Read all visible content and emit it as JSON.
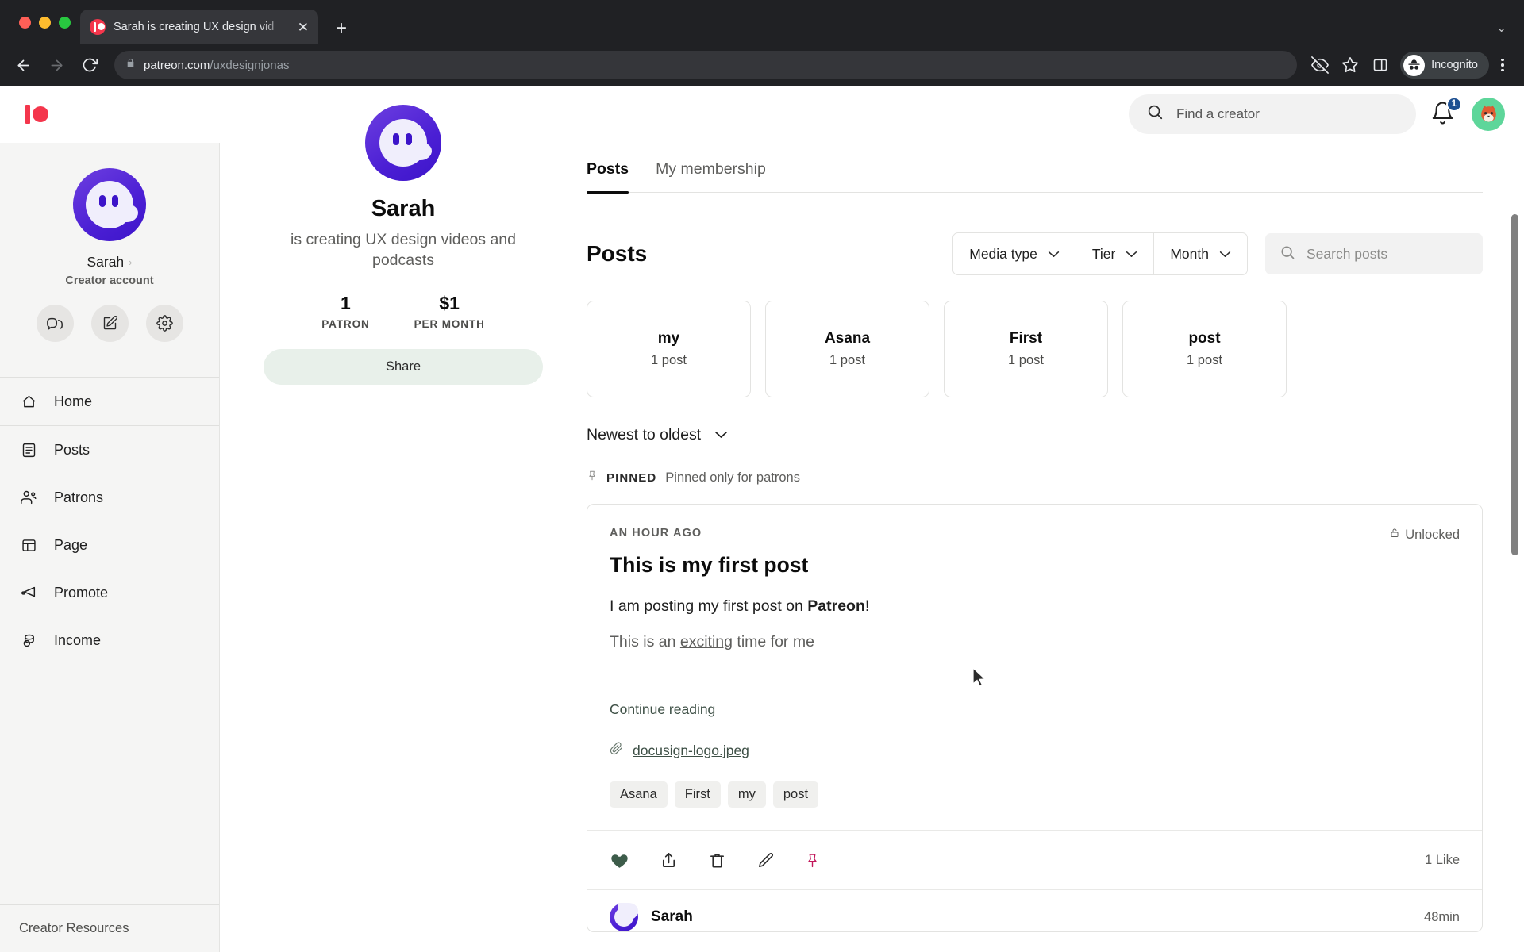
{
  "browser": {
    "tab": {
      "title": "Sarah is creating UX design vid",
      "favicon": "patreon-favicon",
      "close": "✕"
    },
    "newtab_label": "+",
    "tabstrip_chevron": "⌄",
    "back_label": "←",
    "forward_label": "→",
    "reload_label": "↻",
    "url_domain": "patreon.com",
    "url_path": "/uxdesignjonas",
    "profile_label": "Incognito",
    "icons": [
      "lock-icon",
      "eye-off-icon",
      "star-icon",
      "side-panel-icon",
      "incognito-icon",
      "kebab-menu-icon"
    ]
  },
  "topnav": {
    "logo": "patreon-logo",
    "search": {
      "placeholder": "Find a creator",
      "value": ""
    },
    "notifications": {
      "count": "1",
      "badge_color": "#1d4f91"
    },
    "avatar": "fox-avatar"
  },
  "sidebar": {
    "profile": {
      "name": "Sarah",
      "role": "Creator account",
      "chevron": "›",
      "avatar": "ghost-avatar"
    },
    "quick_actions": [
      {
        "name": "messages-button",
        "icon": "chat-bubbles-icon"
      },
      {
        "name": "compose-button",
        "icon": "pencil-square-icon"
      },
      {
        "name": "settings-button",
        "icon": "gear-icon"
      }
    ],
    "items": [
      {
        "label": "Home",
        "icon": "home-icon"
      },
      {
        "label": "Posts",
        "icon": "document-icon"
      },
      {
        "label": "Patrons",
        "icon": "people-icon"
      },
      {
        "label": "Page",
        "icon": "layout-icon"
      },
      {
        "label": "Promote",
        "icon": "megaphone-icon"
      },
      {
        "label": "Income",
        "icon": "coins-icon"
      }
    ],
    "footer_label": "Creator Resources"
  },
  "creator": {
    "avatar": "ghost-avatar",
    "name": "Sarah",
    "tagline": "is creating UX design videos and podcasts",
    "stats": [
      {
        "value": "1",
        "label": "PATRON"
      },
      {
        "value": "$1",
        "label": "PER MONTH"
      }
    ],
    "share_label": "Share"
  },
  "main": {
    "tabs": [
      {
        "label": "Posts",
        "active": true
      },
      {
        "label": "My membership",
        "active": false
      }
    ],
    "heading": "Posts",
    "filters": [
      {
        "label": "Media type",
        "icon": "chevron-down-icon"
      },
      {
        "label": "Tier",
        "icon": "chevron-down-icon"
      },
      {
        "label": "Month",
        "icon": "chevron-down-icon"
      }
    ],
    "search_posts": {
      "placeholder": "Search posts",
      "value": ""
    },
    "tag_cards": [
      {
        "title": "my",
        "subtitle": "1 post"
      },
      {
        "title": "Asana",
        "subtitle": "1 post"
      },
      {
        "title": "First",
        "subtitle": "1 post"
      },
      {
        "title": "post",
        "subtitle": "1 post"
      }
    ],
    "sort": {
      "label": "Newest to oldest",
      "icon": "chevron-down-icon"
    },
    "pinned": {
      "keyword": "PINNED",
      "note": "Pinned only for patrons",
      "icon": "pin-icon"
    },
    "post": {
      "timestamp": "AN HOUR AGO",
      "lock_status": "Unlocked",
      "lock_icon": "unlock-icon",
      "title": "This is my first post",
      "paragraph_1_pre": "I am posting my first post on ",
      "paragraph_1_bold": "Patreon",
      "paragraph_1_post": "!",
      "paragraph_2_pre": "This is an ",
      "paragraph_2_link": "exciting",
      "paragraph_2_post": " time for me",
      "continue_label": "Continue reading",
      "attachment": {
        "name": "docusign-logo.jpeg",
        "icon": "paperclip-icon"
      },
      "chips": [
        "Asana",
        "First",
        "my",
        "post"
      ],
      "actions": [
        {
          "name": "like-button",
          "icon": "heart-filled-icon",
          "color": "#3d5c4a"
        },
        {
          "name": "share-button",
          "icon": "share-up-icon",
          "color": "#2b2b2b"
        },
        {
          "name": "delete-button",
          "icon": "trash-icon",
          "color": "#2b2b2b"
        },
        {
          "name": "edit-button",
          "icon": "pencil-icon",
          "color": "#2b2b2b"
        },
        {
          "name": "unpin-button",
          "icon": "pin-icon",
          "color": "#c2185b"
        }
      ],
      "likes_label": "1 Like",
      "comment": {
        "author": "Sarah",
        "time": "48min",
        "avatar": "ghost-avatar"
      }
    }
  }
}
